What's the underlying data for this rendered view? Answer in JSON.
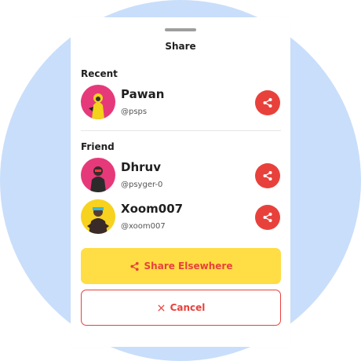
{
  "title": "Share",
  "sections": {
    "recent": "Recent",
    "friend": "Friend"
  },
  "contacts": [
    {
      "name": "Pawan",
      "handle": "@psps",
      "avatar_bg": "#e6397a",
      "share_icon": "share-icon"
    },
    {
      "name": "Dhruv",
      "handle": "@psyger-0",
      "avatar_bg": "#e6397a",
      "share_icon": "share-icon"
    },
    {
      "name": "Xoom007",
      "handle": "@xoom007",
      "avatar_bg": "#f7d21e",
      "share_icon": "share-icon"
    }
  ],
  "buttons": {
    "share_elsewhere": "Share Elsewhere",
    "cancel": "Cancel"
  },
  "colors": {
    "accent": "#e8413c",
    "primary_button": "#ffdd44",
    "background_circle": "#c9defa"
  }
}
